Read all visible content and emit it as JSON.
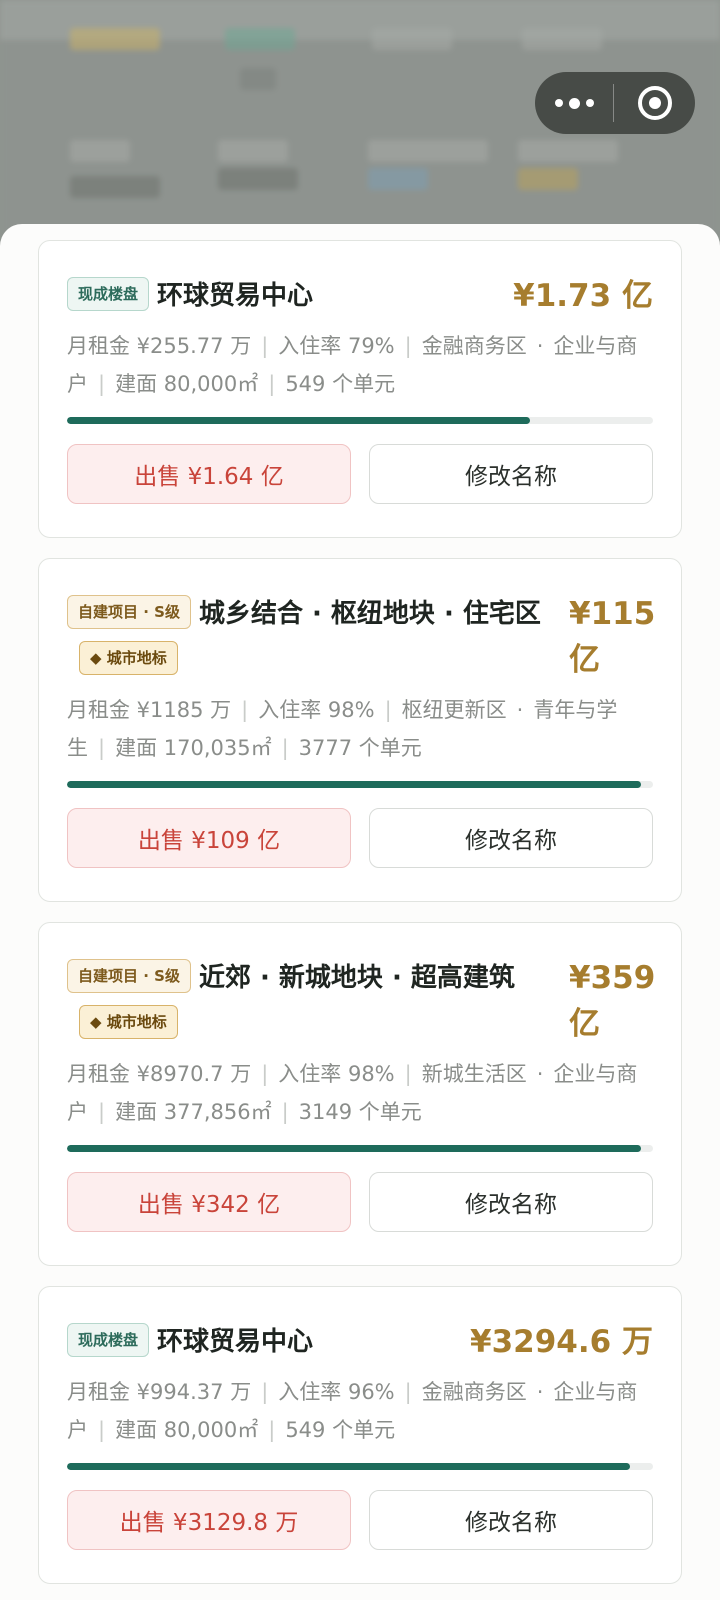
{
  "colors": {
    "accent_price": "#a67d2e",
    "progress": "#1e6b5b",
    "sell_text": "#c9443a",
    "sell_bg": "#fdeeee"
  },
  "capsule": {
    "more_icon": "more-dots-icon",
    "close_icon": "target-circle-icon"
  },
  "properties": [
    {
      "tag": "现成楼盘",
      "name": "环球贸易中心",
      "price": "¥1.73 亿",
      "rent": "月租金 ¥255.77 万",
      "occupancy": "入住率 79%",
      "district": "金融商务区",
      "audience": "企业与商户",
      "area": "建面 80,000㎡",
      "units": "549 个单元",
      "occupancy_value": 0.79,
      "sell_label": "出售 ¥1.64 亿",
      "rename_label": "修改名称"
    },
    {
      "tag": "自建项目 · S级",
      "name": "城乡结合 · 枢纽地块 · 住宅区",
      "landmark": "◆ 城市地标",
      "price": "¥115 亿",
      "rent": "月租金 ¥1185 万",
      "occupancy": "入住率 98%",
      "district": "枢纽更新区",
      "audience": "青年与学生",
      "area": "建面 170,035㎡",
      "units": "3777 个单元",
      "occupancy_value": 0.98,
      "sell_label": "出售 ¥109 亿",
      "rename_label": "修改名称"
    },
    {
      "tag": "自建项目 · S级",
      "name": "近郊 · 新城地块 · 超高建筑",
      "landmark": "◆ 城市地标",
      "price": "¥359 亿",
      "rent": "月租金 ¥8970.7 万",
      "occupancy": "入住率 98%",
      "district": "新城生活区",
      "audience": "企业与商户",
      "area": "建面 377,856㎡",
      "units": "3149 个单元",
      "occupancy_value": 0.98,
      "sell_label": "出售 ¥342 亿",
      "rename_label": "修改名称"
    },
    {
      "tag": "现成楼盘",
      "name": "环球贸易中心",
      "price": "¥3294.6 万",
      "rent": "月租金 ¥994.37 万",
      "occupancy": "入住率 96%",
      "district": "金融商务区",
      "audience": "企业与商户",
      "area": "建面 80,000㎡",
      "units": "549 个单元",
      "occupancy_value": 0.96,
      "sell_label": "出售 ¥3129.8 万",
      "rename_label": "修改名称"
    }
  ]
}
